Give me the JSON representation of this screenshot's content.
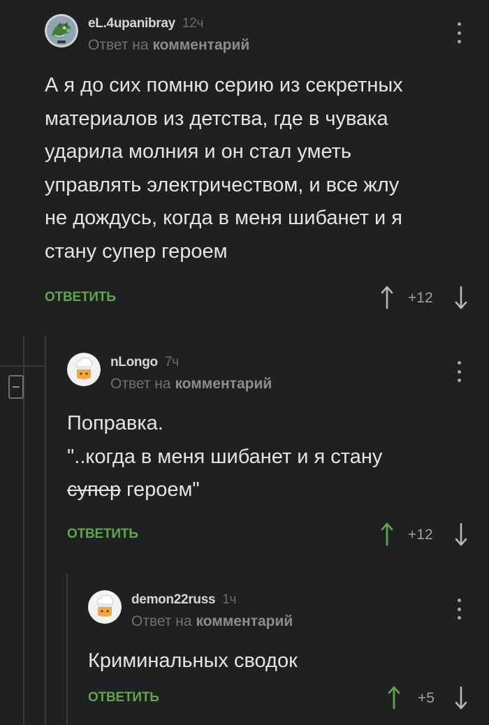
{
  "comments": [
    {
      "author": "eL.4upanibray",
      "time": "12ч",
      "reply_prefix": "Ответ на",
      "reply_link": "комментарий",
      "text_lines": [
        "А я до сих помню серию из секретных",
        "материалов из детства, где в чувака",
        "ударила молния и он стал уметь",
        "управлять электричеством, и все жлу",
        "не дождусь, когда в меня шибанет и я",
        "стану супер героем"
      ],
      "reply_label": "ОТВЕТИТЬ",
      "rating": "+12",
      "avatar_icon": "green-dragon-avatar",
      "upvoted": false
    },
    {
      "author": "nLongo",
      "time": "7ч",
      "reply_prefix": "Ответ на",
      "reply_link": "комментарий",
      "text_line1": "Поправка.",
      "text_line2": "\"..когда в меня шибанет и я стану",
      "text_strike": "супер",
      "text_tail": " героем\"",
      "reply_label": "ОТВЕТИТЬ",
      "rating": "+12",
      "avatar_icon": "default-chef-avatar",
      "upvoted": true
    },
    {
      "author": "demon22russ",
      "time": "1ч",
      "reply_prefix": "Ответ на",
      "reply_link": "комментарий",
      "text": "Криминальных сводок",
      "reply_label": "ОТВЕТИТЬ",
      "rating": "+5",
      "avatar_icon": "default-chef-avatar",
      "upvoted": true
    }
  ],
  "colors": {
    "background": "#1f2021",
    "accent_green": "#5fa64b",
    "text": "#e4e4e4",
    "muted": "#6f7173"
  },
  "icons": [
    "collapse-thread-icon",
    "menu-dots-icon",
    "upvote-arrow-icon",
    "downvote-arrow-icon"
  ]
}
